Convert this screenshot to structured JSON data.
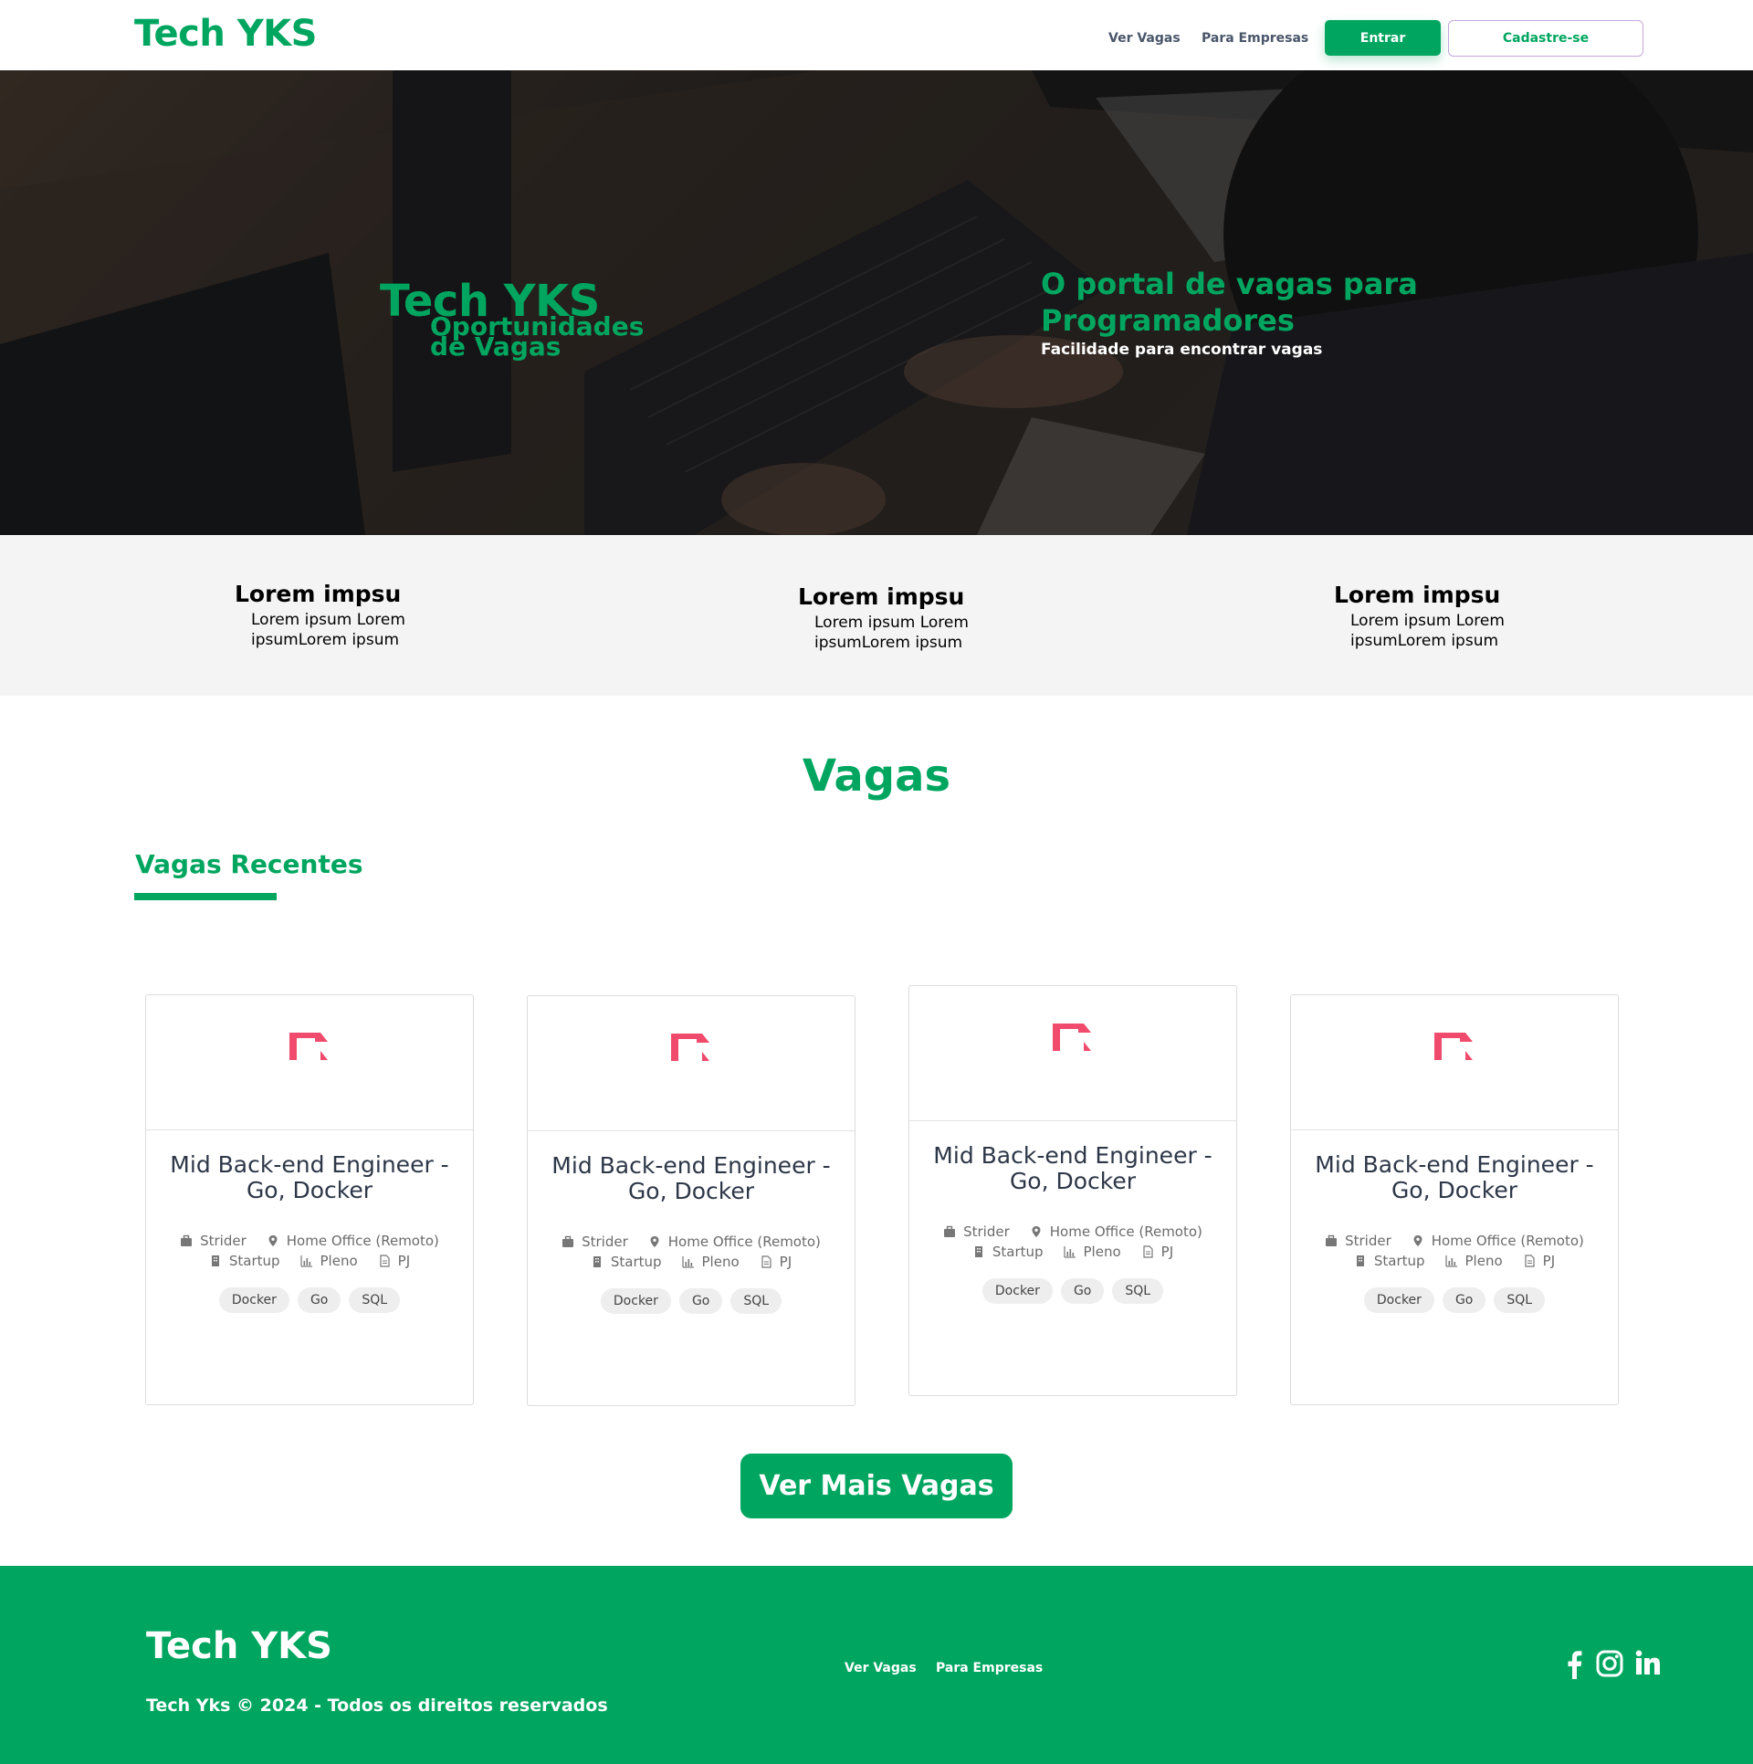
{
  "header": {
    "brand": "Tech YKS",
    "nav": {
      "vagas": "Ver Vagas",
      "empresas": "Para Empresas"
    },
    "login_label": "Entrar",
    "signup_label": "Cadastre-se"
  },
  "hero": {
    "title": "Tech YKS",
    "subtitle": "Oportunidades de Vagas",
    "tagline": "O portal de vagas para Programadores",
    "tagline_sub": "Facilidade para encontrar vagas"
  },
  "features": [
    {
      "title": "Lorem impsu",
      "text": "Lorem ipsum Lorem ipsumLorem ipsum"
    },
    {
      "title": "Lorem impsu",
      "text": "Lorem ipsum Lorem ipsumLorem ipsum"
    },
    {
      "title": "Lorem impsu",
      "text": "Lorem ipsum Lorem ipsumLorem ipsum"
    }
  ],
  "jobs_section": {
    "title": "Vagas",
    "recent_title": "Vagas Recentes",
    "more_label": "Ver Mais Vagas"
  },
  "jobs": [
    {
      "title": "Mid Back-end Engineer - Go, Docker",
      "company": "Strider",
      "location": "Home Office (Remoto)",
      "company_type": "Startup",
      "level": "Pleno",
      "contract": "PJ",
      "tags": [
        "Docker",
        "Go",
        "SQL"
      ]
    },
    {
      "title": "Mid Back-end Engineer - Go, Docker",
      "company": "Strider",
      "location": "Home Office (Remoto)",
      "company_type": "Startup",
      "level": "Pleno",
      "contract": "PJ",
      "tags": [
        "Docker",
        "Go",
        "SQL"
      ]
    },
    {
      "title": "Mid Back-end Engineer - Go, Docker",
      "company": "Strider",
      "location": "Home Office (Remoto)",
      "company_type": "Startup",
      "level": "Pleno",
      "contract": "PJ",
      "tags": [
        "Docker",
        "Go",
        "SQL"
      ]
    },
    {
      "title": "Mid Back-end Engineer - Go, Docker",
      "company": "Strider",
      "location": "Home Office (Remoto)",
      "company_type": "Startup",
      "level": "Pleno",
      "contract": "PJ",
      "tags": [
        "Docker",
        "Go",
        "SQL"
      ]
    }
  ],
  "footer": {
    "brand": "Tech YKS",
    "copyright": "Tech Yks © 2024 - Todos os direitos reservados",
    "nav": {
      "vagas": "Ver Vagas",
      "empresas": "Para Empresas"
    },
    "social_icons": [
      "facebook-icon",
      "instagram-icon",
      "linkedin-icon"
    ]
  },
  "colors": {
    "brand": "#00a65f",
    "logo_accent": "#f04b6c",
    "footer_bg": "#00a65f"
  }
}
